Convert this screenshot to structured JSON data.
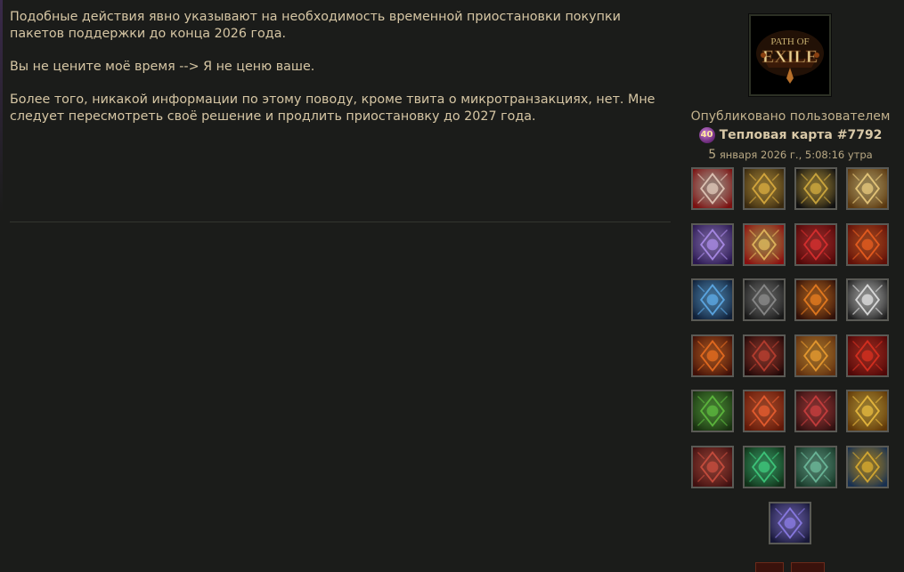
{
  "post": {
    "paragraphs": [
      "Подобные действия явно указывают на необходимость временной приостановки покупки пакетов поддержки до конца 2026 года.",
      "Вы не цените моё время --> Я не ценю ваше.",
      "Более того, никакой информации по этому поводу, кроме твита о микротранзакциях, нет. Мне следует пересмотреть своё решение и продлить приостановку до 2027 года."
    ]
  },
  "sidebar": {
    "logo_text": "PATH OF EXILE",
    "posted_by_label": "Опубликовано пользователем",
    "level": "40",
    "author": "Тепловая карта #7792",
    "date_day": "5",
    "date_rest": " января 2026 г., 5:08:16 утра"
  },
  "badges": [
    {
      "name": "red-wings-badge-icon",
      "bg": "#7a1010",
      "fg": "#e8d0c0"
    },
    {
      "name": "gold-emblem-badge-icon",
      "bg": "#3a2a10",
      "fg": "#e0b040"
    },
    {
      "name": "gold-diamond-badge-icon",
      "bg": "#101010",
      "fg": "#d8b040"
    },
    {
      "name": "gold-skull-badge-icon",
      "bg": "#5a3810",
      "fg": "#f0d080"
    },
    {
      "name": "purple-crystal-badge-icon",
      "bg": "#2a1850",
      "fg": "#b090f0"
    },
    {
      "name": "gold-red-banner-badge-icon",
      "bg": "#8a1010",
      "fg": "#e8c060"
    },
    {
      "name": "red-orb-badge-icon",
      "bg": "#500808",
      "fg": "#e03030"
    },
    {
      "name": "red-demon-badge-icon",
      "bg": "#601008",
      "fg": "#f06020"
    },
    {
      "name": "blue-sword-badge-icon",
      "bg": "#102038",
      "fg": "#60b0f0"
    },
    {
      "name": "dark-chain-badge-icon",
      "bg": "#181818",
      "fg": "#909090"
    },
    {
      "name": "fire-portal-badge-icon",
      "bg": "#301008",
      "fg": "#f08020"
    },
    {
      "name": "white-sigil-badge-icon",
      "bg": "#202020",
      "fg": "#e8e8e8"
    },
    {
      "name": "fire-gate-badge-icon",
      "bg": "#401008",
      "fg": "#f07020"
    },
    {
      "name": "dark-helm-badge-icon",
      "bg": "#200808",
      "fg": "#c04030"
    },
    {
      "name": "flame-arch-badge-icon",
      "bg": "#603010",
      "fg": "#f0a030"
    },
    {
      "name": "red-beast-badge-icon",
      "bg": "#500808",
      "fg": "#e03020"
    },
    {
      "name": "green-guardian-badge-icon",
      "bg": "#183010",
      "fg": "#60c040"
    },
    {
      "name": "red-skull-badge-icon",
      "bg": "#601808",
      "fg": "#f06030"
    },
    {
      "name": "crimson-mask-badge-icon",
      "bg": "#301010",
      "fg": "#d04040"
    },
    {
      "name": "golden-sun-badge-icon",
      "bg": "#603808",
      "fg": "#f0c040"
    },
    {
      "name": "red-knight-badge-icon",
      "bg": "#401010",
      "fg": "#d05040"
    },
    {
      "name": "green-demon-badge-icon",
      "bg": "#103018",
      "fg": "#40d080"
    },
    {
      "name": "jade-skull-badge-icon",
      "bg": "#183828",
      "fg": "#70c0a0"
    },
    {
      "name": "blue-gold-crest-badge-icon",
      "bg": "#183050",
      "fg": "#e0b030"
    },
    {
      "name": "void-hand-badge-icon",
      "bg": "#181838",
      "fg": "#9080f0"
    }
  ]
}
